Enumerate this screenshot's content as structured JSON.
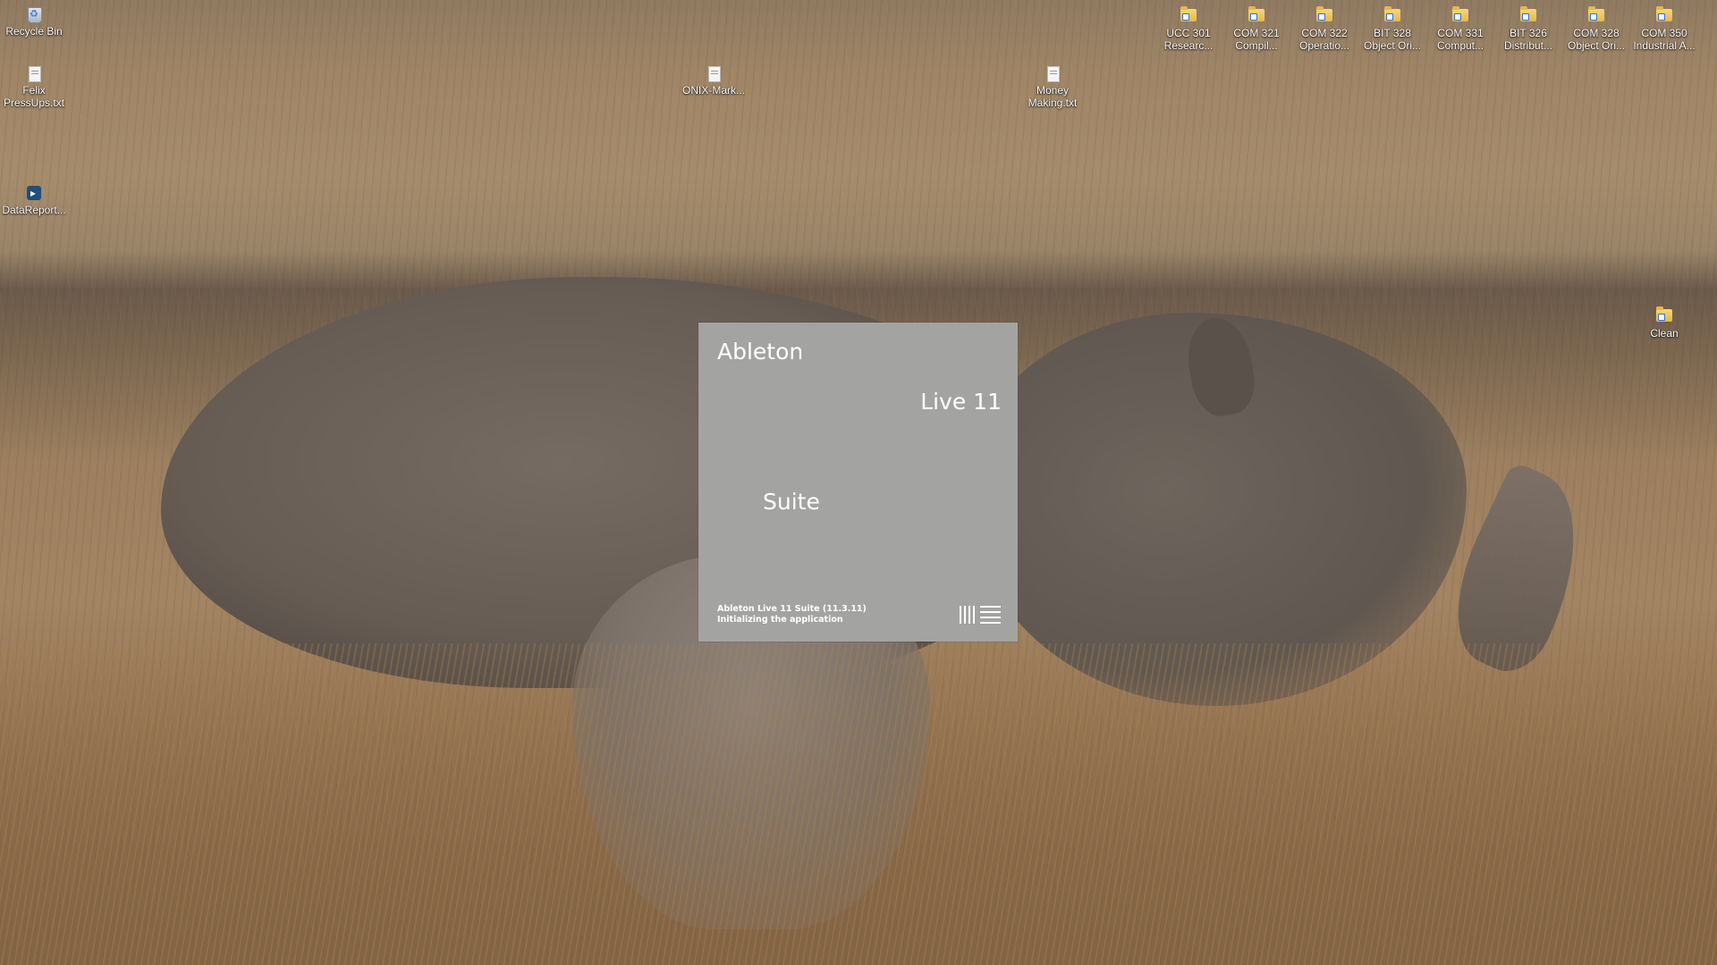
{
  "desktop": {
    "icons_left": [
      {
        "label": "Recycle Bin",
        "icon": "recycle-bin-icon"
      },
      {
        "label": "Felix\nPressUps.txt",
        "icon": "text-file-icon"
      },
      {
        "label": "DataReport...",
        "icon": "app-shortcut-icon"
      }
    ],
    "icons_middle": [
      {
        "label": "ONIX-Mark...",
        "icon": "text-file-icon"
      },
      {
        "label": "Money\nMaking.txt",
        "icon": "text-file-icon"
      }
    ],
    "icons_top_right": [
      {
        "label": "UCC 301\nResearc...",
        "icon": "folder-icon"
      },
      {
        "label": "COM 321\nCompil...",
        "icon": "folder-icon"
      },
      {
        "label": "COM 322\nOperatio...",
        "icon": "folder-icon"
      },
      {
        "label": "BIT 328\nObject Ori...",
        "icon": "folder-icon"
      },
      {
        "label": "COM 331\nComput...",
        "icon": "folder-icon"
      },
      {
        "label": "BIT 326\nDistribut...",
        "icon": "folder-icon"
      },
      {
        "label": "COM 328\nObject Ori...",
        "icon": "folder-icon"
      },
      {
        "label": "COM 350\nIndustrial A...",
        "icon": "folder-icon"
      }
    ],
    "icon_clean": {
      "label": "Clean",
      "icon": "folder-icon"
    }
  },
  "splash": {
    "brand": "Ableton",
    "product": "Live 11",
    "edition": "Suite",
    "version_line": "Ableton Live 11 Suite (11.3.11)",
    "status_line": "Initializing the application",
    "logo_icon": "ableton-logo-icon",
    "background_color": "#a3a3a2",
    "text_color": "#ffffff"
  }
}
